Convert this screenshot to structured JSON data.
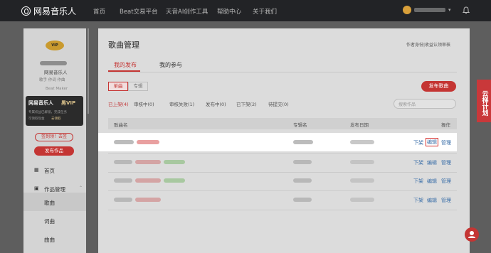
{
  "topbar": {
    "logo": "网易音乐人",
    "nav": [
      "首页",
      "Beat交易平台",
      "天音AI创作工具",
      "帮助中心",
      "关于我们"
    ]
  },
  "sidebar": {
    "vip_badge": "VIP",
    "role": "网易音乐人",
    "stats": "歌手  作词  作曲",
    "meta": "Beat Maker",
    "vip_title": "网易音乐人",
    "vip_suffix": "黑VIP",
    "vip_desc1": "专属权益已解锁，完成任务",
    "vip_desc2": "可领取现金",
    "vip_link": "去领取",
    "checkin": "签到领！去签",
    "publish": "发布作品",
    "menu_home": "首页",
    "menu_works": "作品管理",
    "sub_song": "歌曲",
    "sub_lyric": "词曲",
    "sub_beat": "曲曲"
  },
  "main": {
    "title": "歌曲管理",
    "top_link": "作者身份|收益认领审核",
    "tabs": [
      "我的发布",
      "我的参与"
    ],
    "type_tabs": [
      "单曲",
      "专辑"
    ],
    "publish_button": "发布歌曲",
    "filters": [
      "已上架(4)",
      "审核中(0)",
      "审核失败(1)",
      "发布中(0)",
      "已下架(2)",
      "待提交(0)"
    ],
    "search_placeholder": "搜索作品",
    "columns": [
      "歌曲名",
      "专辑名",
      "发布日期",
      "操作"
    ],
    "actions": [
      "下架",
      "编辑",
      "管理"
    ]
  },
  "side_tag": "云梯计划",
  "colors": {
    "accent": "#c43533",
    "topbar": "#222326",
    "overlay": "#5e5e5e"
  }
}
